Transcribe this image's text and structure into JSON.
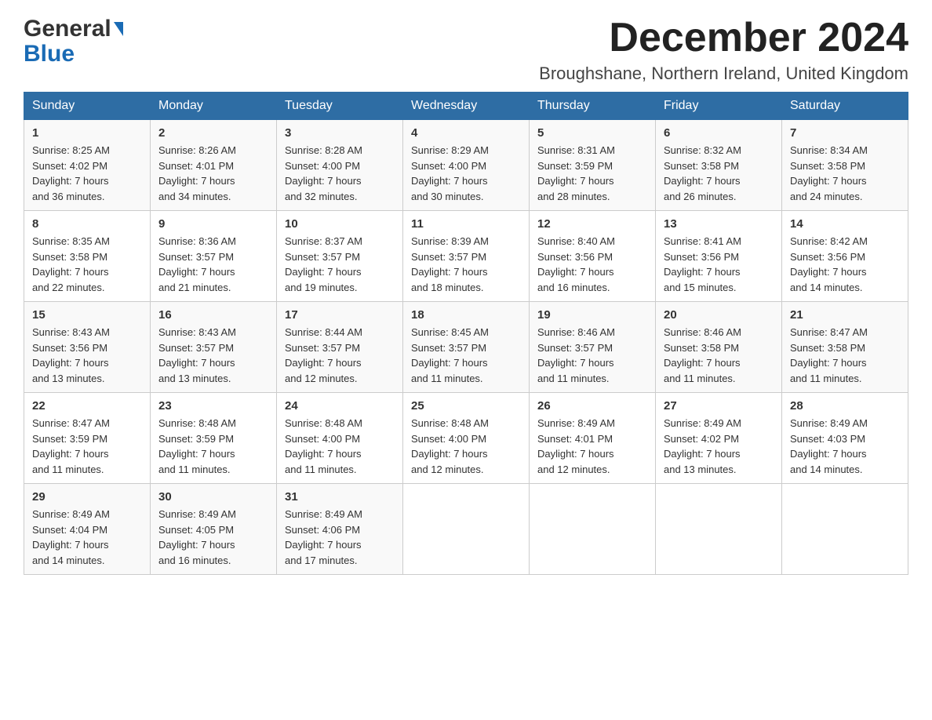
{
  "header": {
    "logo_general": "General",
    "logo_blue": "Blue",
    "month_title": "December 2024",
    "location": "Broughshane, Northern Ireland, United Kingdom"
  },
  "weekdays": [
    "Sunday",
    "Monday",
    "Tuesday",
    "Wednesday",
    "Thursday",
    "Friday",
    "Saturday"
  ],
  "weeks": [
    [
      {
        "day": "1",
        "sunrise": "8:25 AM",
        "sunset": "4:02 PM",
        "daylight": "7 hours and 36 minutes."
      },
      {
        "day": "2",
        "sunrise": "8:26 AM",
        "sunset": "4:01 PM",
        "daylight": "7 hours and 34 minutes."
      },
      {
        "day": "3",
        "sunrise": "8:28 AM",
        "sunset": "4:00 PM",
        "daylight": "7 hours and 32 minutes."
      },
      {
        "day": "4",
        "sunrise": "8:29 AM",
        "sunset": "4:00 PM",
        "daylight": "7 hours and 30 minutes."
      },
      {
        "day": "5",
        "sunrise": "8:31 AM",
        "sunset": "3:59 PM",
        "daylight": "7 hours and 28 minutes."
      },
      {
        "day": "6",
        "sunrise": "8:32 AM",
        "sunset": "3:58 PM",
        "daylight": "7 hours and 26 minutes."
      },
      {
        "day": "7",
        "sunrise": "8:34 AM",
        "sunset": "3:58 PM",
        "daylight": "7 hours and 24 minutes."
      }
    ],
    [
      {
        "day": "8",
        "sunrise": "8:35 AM",
        "sunset": "3:58 PM",
        "daylight": "7 hours and 22 minutes."
      },
      {
        "day": "9",
        "sunrise": "8:36 AM",
        "sunset": "3:57 PM",
        "daylight": "7 hours and 21 minutes."
      },
      {
        "day": "10",
        "sunrise": "8:37 AM",
        "sunset": "3:57 PM",
        "daylight": "7 hours and 19 minutes."
      },
      {
        "day": "11",
        "sunrise": "8:39 AM",
        "sunset": "3:57 PM",
        "daylight": "7 hours and 18 minutes."
      },
      {
        "day": "12",
        "sunrise": "8:40 AM",
        "sunset": "3:56 PM",
        "daylight": "7 hours and 16 minutes."
      },
      {
        "day": "13",
        "sunrise": "8:41 AM",
        "sunset": "3:56 PM",
        "daylight": "7 hours and 15 minutes."
      },
      {
        "day": "14",
        "sunrise": "8:42 AM",
        "sunset": "3:56 PM",
        "daylight": "7 hours and 14 minutes."
      }
    ],
    [
      {
        "day": "15",
        "sunrise": "8:43 AM",
        "sunset": "3:56 PM",
        "daylight": "7 hours and 13 minutes."
      },
      {
        "day": "16",
        "sunrise": "8:43 AM",
        "sunset": "3:57 PM",
        "daylight": "7 hours and 13 minutes."
      },
      {
        "day": "17",
        "sunrise": "8:44 AM",
        "sunset": "3:57 PM",
        "daylight": "7 hours and 12 minutes."
      },
      {
        "day": "18",
        "sunrise": "8:45 AM",
        "sunset": "3:57 PM",
        "daylight": "7 hours and 11 minutes."
      },
      {
        "day": "19",
        "sunrise": "8:46 AM",
        "sunset": "3:57 PM",
        "daylight": "7 hours and 11 minutes."
      },
      {
        "day": "20",
        "sunrise": "8:46 AM",
        "sunset": "3:58 PM",
        "daylight": "7 hours and 11 minutes."
      },
      {
        "day": "21",
        "sunrise": "8:47 AM",
        "sunset": "3:58 PM",
        "daylight": "7 hours and 11 minutes."
      }
    ],
    [
      {
        "day": "22",
        "sunrise": "8:47 AM",
        "sunset": "3:59 PM",
        "daylight": "7 hours and 11 minutes."
      },
      {
        "day": "23",
        "sunrise": "8:48 AM",
        "sunset": "3:59 PM",
        "daylight": "7 hours and 11 minutes."
      },
      {
        "day": "24",
        "sunrise": "8:48 AM",
        "sunset": "4:00 PM",
        "daylight": "7 hours and 11 minutes."
      },
      {
        "day": "25",
        "sunrise": "8:48 AM",
        "sunset": "4:00 PM",
        "daylight": "7 hours and 12 minutes."
      },
      {
        "day": "26",
        "sunrise": "8:49 AM",
        "sunset": "4:01 PM",
        "daylight": "7 hours and 12 minutes."
      },
      {
        "day": "27",
        "sunrise": "8:49 AM",
        "sunset": "4:02 PM",
        "daylight": "7 hours and 13 minutes."
      },
      {
        "day": "28",
        "sunrise": "8:49 AM",
        "sunset": "4:03 PM",
        "daylight": "7 hours and 14 minutes."
      }
    ],
    [
      {
        "day": "29",
        "sunrise": "8:49 AM",
        "sunset": "4:04 PM",
        "daylight": "7 hours and 14 minutes."
      },
      {
        "day": "30",
        "sunrise": "8:49 AM",
        "sunset": "4:05 PM",
        "daylight": "7 hours and 16 minutes."
      },
      {
        "day": "31",
        "sunrise": "8:49 AM",
        "sunset": "4:06 PM",
        "daylight": "7 hours and 17 minutes."
      },
      null,
      null,
      null,
      null
    ]
  ],
  "labels": {
    "sunrise": "Sunrise:",
    "sunset": "Sunset:",
    "daylight": "Daylight:"
  }
}
